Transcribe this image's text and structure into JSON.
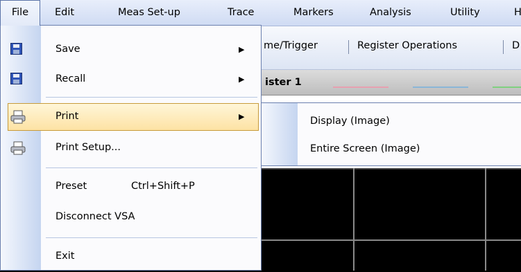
{
  "menubar": {
    "items": [
      {
        "label": "File"
      },
      {
        "label": "Edit"
      },
      {
        "label": "Meas Set-up"
      },
      {
        "label": "Trace"
      },
      {
        "label": "Markers"
      },
      {
        "label": "Analysis"
      },
      {
        "label": "Utility"
      },
      {
        "label": "H"
      }
    ]
  },
  "toolbar": {
    "items": [
      {
        "label": "me/Trigger"
      },
      {
        "label": "Register Operations"
      },
      {
        "label": "D"
      }
    ]
  },
  "register_bar": {
    "label": "ister 1",
    "line_colors": [
      "#e7a0b0",
      "#8ab6d8",
      "#7fd07f"
    ]
  },
  "file_menu": {
    "items": [
      {
        "label": "Save",
        "icon": "floppy-save-icon",
        "submenu": true
      },
      {
        "label": "Recall",
        "icon": "floppy-recall-icon",
        "submenu": true
      },
      {
        "label": "Print",
        "icon": "printer-icon",
        "submenu": true,
        "highlighted": true
      },
      {
        "label": "Print Setup...",
        "icon": "printer-setup-icon"
      },
      {
        "label": "Preset",
        "shortcut": "Ctrl+Shift+P"
      },
      {
        "label": "Disconnect VSA"
      },
      {
        "label": "Exit"
      }
    ]
  },
  "print_submenu": {
    "items": [
      {
        "label": "Display (Image)"
      },
      {
        "label": "Entire Screen (Image)"
      }
    ]
  },
  "colors": {
    "highlight_fill": "#fde2a4",
    "highlight_border": "#c79a3a",
    "menu_border": "#6a7fae",
    "trace_bg": "#000000",
    "grid": "#8a8a8a"
  }
}
